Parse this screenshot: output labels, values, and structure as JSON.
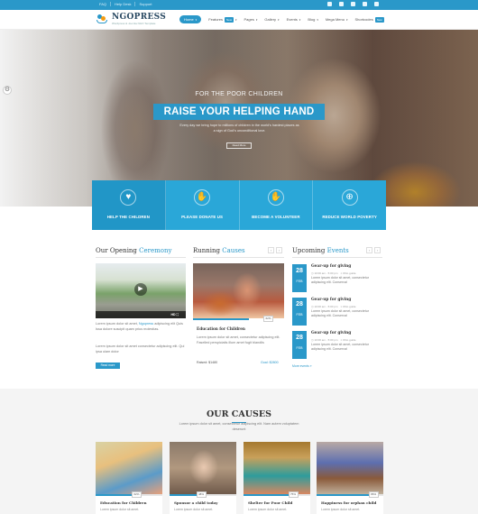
{
  "topbar": {
    "links": [
      "FAQ",
      "Help Desk",
      "Support"
    ]
  },
  "header": {
    "logo_name": "NGOPRESS",
    "logo_tagline": "Wordpress & Joomla NGO Template",
    "nav": [
      {
        "label": "Home",
        "caret": "▾",
        "badge": "",
        "active": true
      },
      {
        "label": "Features",
        "caret": "▾",
        "badge": "New",
        "active": false
      },
      {
        "label": "Pages",
        "caret": "▾",
        "badge": "",
        "active": false
      },
      {
        "label": "Gallery",
        "caret": "▾",
        "badge": "",
        "active": false
      },
      {
        "label": "Events",
        "caret": "▾",
        "badge": "",
        "active": false
      },
      {
        "label": "Blog",
        "caret": "▾",
        "badge": "",
        "active": false
      },
      {
        "label": "Mega Menu",
        "caret": "▾",
        "badge": "",
        "active": false
      },
      {
        "label": "Shortcodes",
        "caret": "",
        "badge": "New",
        "active": false
      }
    ]
  },
  "hero": {
    "subtitle": "FOR THE POOR CHILDREN",
    "title": "RAISE YOUR HELPING HAND",
    "description": "Every day we bring hope to millions of children in the world's hardest places as a sign of God's unconditional love.",
    "button": "Read More"
  },
  "features": [
    {
      "label": "HELP THE CHILDREN",
      "icon": "heart-hand-icon"
    },
    {
      "label": "PLEASE DONATE US",
      "icon": "donate-icon"
    },
    {
      "label": "BECOME A VOLUNTEER",
      "icon": "hand-icon"
    },
    {
      "label": "REDUCE WORLD POVERTY",
      "icon": "globe-hand-icon"
    }
  ],
  "ceremony": {
    "title_plain": "Our Opening",
    "title_accent": "Ceremony",
    "text1_pre": "Lorem ipsum dolor sit amet,",
    "text1_link": "Ngopress",
    "text1_post": "adipiscing elit Quis Issa dolore suscipit quam prius molestias.",
    "text2": "Lorem ipsum dolor sit amet consectetur adipiscing elit. Qui ipsa ulam dolor",
    "button": "Read more"
  },
  "running": {
    "title_plain": "Running",
    "title_accent": "Causes",
    "pct": "62%",
    "card_title": "Education for Children",
    "text": "Lorem ipsum dolor sit amet, consectetur adipiscing elit. Faselled perspiciatis illum amet fugit blandiis",
    "raised_label": "Raised: $1480",
    "goal_label": "Goal: $2800"
  },
  "events": {
    "title_plain": "Upcoming",
    "title_accent": "Events",
    "items": [
      {
        "day": "28",
        "month": "FEB",
        "title": "Gear-up for giving",
        "meta1": "◷ 10:00 am - 5:00 pm",
        "meta2": "⌖ Ohio guide",
        "text": "Lorem ipsum dolor sit amet, consectetur adipiscing elit. Conserval"
      },
      {
        "day": "28",
        "month": "FEB",
        "title": "Gear-up for giving",
        "meta1": "◷ 10:00 am - 5:00 pm",
        "meta2": "⌖ Ohio guide",
        "text": "Lorem ipsum dolor sit amet, consectetur adipiscing elit. Conserval"
      },
      {
        "day": "28",
        "month": "FEB",
        "title": "Gear-up for giving",
        "meta1": "◷ 10:00 am - 5:00 pm",
        "meta2": "⌖ Ohio guide",
        "text": "Lorem ipsum dolor sit amet, consectetur adipiscing elit. Conserval"
      }
    ],
    "more": "More events »"
  },
  "causes": {
    "heading": "OUR CAUSES",
    "text": "Lorem ipsum dolor sit amet, consectetur adipiscing elit. Nam autem voluptatem deserunt",
    "cards": [
      {
        "title": "Education for Children",
        "pct": "62%",
        "text": "Lorem ipsum dolor sit amet.",
        "progress": 0.62
      },
      {
        "title": "Sponsor a child today",
        "pct": "48%",
        "text": "Lorem ipsum dolor sit amet.",
        "progress": 0.48
      },
      {
        "title": "Shelter for Poor Child",
        "pct": "75%",
        "text": "Lorem ipsum dolor sit amet.",
        "progress": 0.75
      },
      {
        "title": "Happiness for orphan child",
        "pct": "86%",
        "text": "Lorem ipsum dolor sit amet.",
        "progress": 0.86
      }
    ]
  }
}
